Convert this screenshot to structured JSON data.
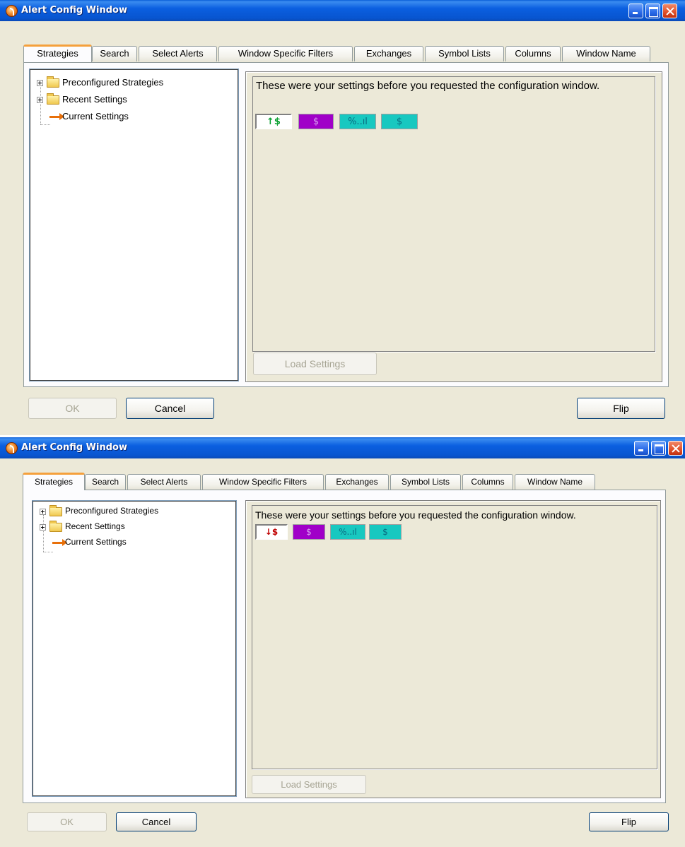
{
  "windows": [
    {
      "title": "Alert Config Window",
      "tabs": [
        "Strategies",
        "Search",
        "Select Alerts",
        "Window Specific Filters",
        "Exchanges",
        "Symbol Lists",
        "Columns",
        "Window Name"
      ],
      "active_tab": "Strategies",
      "tree": [
        {
          "label": "Preconfigured Strategies",
          "icon": "folder-icon",
          "expandable": true
        },
        {
          "label": "Recent Settings",
          "icon": "folder-icon",
          "expandable": true
        },
        {
          "label": "Current Settings",
          "icon": "arrow-right-icon",
          "expandable": false
        }
      ],
      "description": "These were your settings before you requested the configuration window.",
      "alert_icons": [
        {
          "glyph": "↑$",
          "name": "new-high-dollar-icon",
          "color": "#0aa030"
        },
        {
          "glyph": "$",
          "name": "dollar-filter-icon-purple",
          "color": "#a000c8"
        },
        {
          "glyph": "%..ıl",
          "name": "percent-volume-icon",
          "color": "#18c8c0"
        },
        {
          "glyph": "$",
          "name": "dollar-filter-icon-teal",
          "color": "#18c8c0"
        }
      ],
      "load_button": "Load Settings",
      "ok_button": "OK",
      "cancel_button": "Cancel",
      "flip_button": "Flip"
    },
    {
      "title": "Alert Config Window",
      "tabs": [
        "Strategies",
        "Search",
        "Select Alerts",
        "Window Specific Filters",
        "Exchanges",
        "Symbol Lists",
        "Columns",
        "Window Name"
      ],
      "active_tab": "Strategies",
      "tree": [
        {
          "label": "Preconfigured Strategies",
          "icon": "folder-icon",
          "expandable": true
        },
        {
          "label": "Recent Settings",
          "icon": "folder-icon",
          "expandable": true
        },
        {
          "label": "Current Settings",
          "icon": "arrow-right-icon",
          "expandable": false
        }
      ],
      "description": "These were your settings before you requested the configuration window.",
      "alert_icons": [
        {
          "glyph": "↓$",
          "name": "new-low-dollar-icon",
          "color": "#c00000"
        },
        {
          "glyph": "$",
          "name": "dollar-filter-icon-purple",
          "color": "#a000c8"
        },
        {
          "glyph": "%..ıl",
          "name": "percent-volume-icon",
          "color": "#18c8c0"
        },
        {
          "glyph": "$",
          "name": "dollar-filter-icon-teal",
          "color": "#18c8c0"
        }
      ],
      "load_button": "Load Settings",
      "ok_button": "OK",
      "cancel_button": "Cancel",
      "flip_button": "Flip"
    }
  ]
}
